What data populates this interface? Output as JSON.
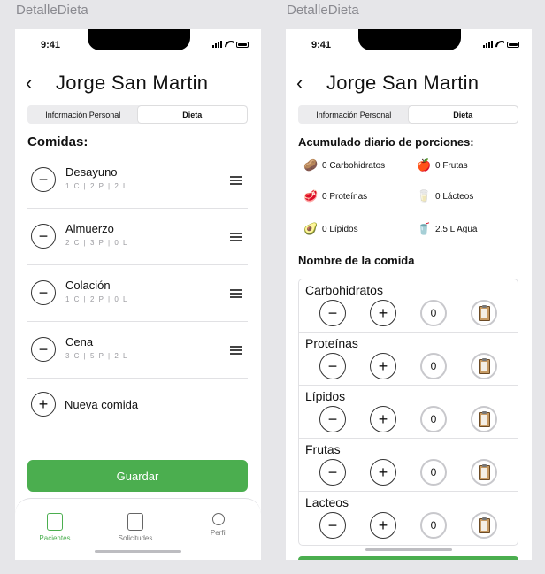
{
  "frames": [
    {
      "label": "DetalleDieta"
    },
    {
      "label": "DetalleDieta"
    }
  ],
  "status_time": "9:41",
  "header": {
    "back_icon": "chevron-left-icon",
    "title": "Jorge San Martin"
  },
  "tabs": [
    "Información Personal",
    "Dieta"
  ],
  "active_tab": "Dieta",
  "left": {
    "section_title": "Comidas:",
    "meals": [
      {
        "name": "Desayuno",
        "portions": "1 C | 2 P | 2 L"
      },
      {
        "name": "Almuerzo",
        "portions": "2 C | 3 P | 0 L"
      },
      {
        "name": "Colación",
        "portions": "1 C | 2 P | 0 L"
      },
      {
        "name": "Cena",
        "portions": "3 C | 5 P | 2 L"
      }
    ],
    "new_meal_label": "Nueva comida",
    "save_label": "Guardar",
    "bottom_nav": [
      {
        "label": "Pacientes",
        "icon": "patient-badge-icon",
        "active": true
      },
      {
        "label": "Solicitudes",
        "icon": "inbox-icon",
        "active": false
      },
      {
        "label": "Perfil",
        "icon": "person-icon",
        "active": false
      }
    ]
  },
  "right": {
    "accumulated_title": "Acumulado diario de porciones:",
    "portions": [
      {
        "icon": "potato-icon",
        "glyph": "🥔",
        "text": "0  Carbohidratos"
      },
      {
        "icon": "apple-icon",
        "glyph": "🍎",
        "text": "0  Frutas"
      },
      {
        "icon": "meat-icon",
        "glyph": "🥩",
        "text": "0  Proteínas"
      },
      {
        "icon": "milk-glass-icon",
        "glyph": "🥛",
        "text": "0  Lácteos"
      },
      {
        "icon": "avocado-icon",
        "glyph": "🥑",
        "text": "0  Lípidos"
      },
      {
        "icon": "water-glass-icon",
        "glyph": "🥤",
        "text": "2.5 L  Agua"
      }
    ],
    "meal_name_title": "Nombre de la comida",
    "nutrients": [
      {
        "name": "Carbohidratos",
        "count": "0"
      },
      {
        "name": "Proteínas",
        "count": "0"
      },
      {
        "name": "Lípidos",
        "count": "0"
      },
      {
        "name": "Frutas",
        "count": "0"
      },
      {
        "name": "Lacteos",
        "count": "0"
      }
    ]
  },
  "colors": {
    "accent": "#4bae4f",
    "background": "#e6e6e9"
  }
}
